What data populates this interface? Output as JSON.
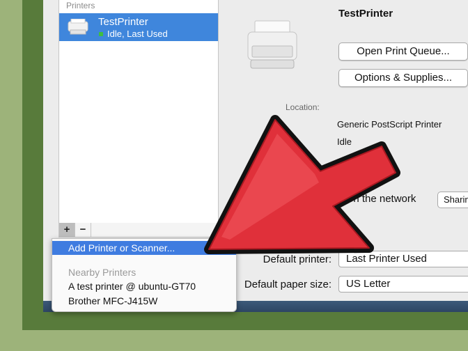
{
  "sidebar": {
    "header": "Printers",
    "printer": {
      "name": "TestPrinter",
      "status": "Idle, Last Used"
    },
    "add_button": "+",
    "remove_button": "−"
  },
  "details": {
    "title": "TestPrinter",
    "open_queue_label": "Open Print Queue...",
    "options_label": "Options & Supplies...",
    "location_label": "Location:",
    "kind_value": "Generic PostScript Printer",
    "status_value": "Idle",
    "share_label": "on the network",
    "share_button": "Sharin"
  },
  "defaults": {
    "printer_label": "Default printer:",
    "printer_value": "Last Printer Used",
    "paper_label": "Default paper size:",
    "paper_value": "US Letter"
  },
  "menu": {
    "add_item": "Add Printer or Scanner...",
    "nearby_header": "Nearby Printers",
    "nearby": [
      "A test printer @ ubuntu-GT70",
      "Brother MFC-J415W"
    ]
  },
  "colors": {
    "selection": "#3f86dc",
    "arrow": "#e0303a",
    "frame_outer": "#9db37a",
    "frame_inner": "#587b3b"
  }
}
